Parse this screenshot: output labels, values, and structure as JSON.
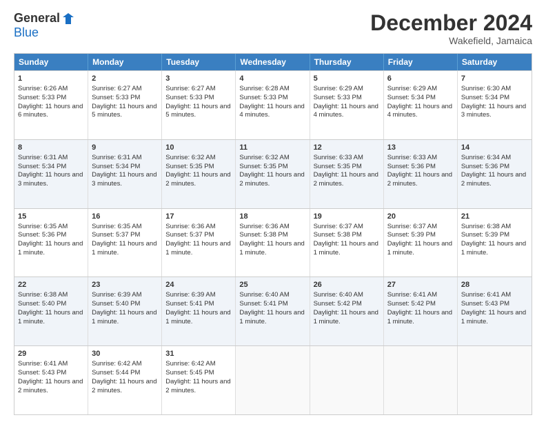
{
  "header": {
    "logo_general": "General",
    "logo_blue": "Blue",
    "month_title": "December 2024",
    "location": "Wakefield, Jamaica"
  },
  "days_of_week": [
    "Sunday",
    "Monday",
    "Tuesday",
    "Wednesday",
    "Thursday",
    "Friday",
    "Saturday"
  ],
  "weeks": [
    [
      {
        "day": 1,
        "sunrise": "6:26 AM",
        "sunset": "5:33 PM",
        "daylight": "11 hours and 6 minutes."
      },
      {
        "day": 2,
        "sunrise": "6:27 AM",
        "sunset": "5:33 PM",
        "daylight": "11 hours and 5 minutes."
      },
      {
        "day": 3,
        "sunrise": "6:27 AM",
        "sunset": "5:33 PM",
        "daylight": "11 hours and 5 minutes."
      },
      {
        "day": 4,
        "sunrise": "6:28 AM",
        "sunset": "5:33 PM",
        "daylight": "11 hours and 4 minutes."
      },
      {
        "day": 5,
        "sunrise": "6:29 AM",
        "sunset": "5:33 PM",
        "daylight": "11 hours and 4 minutes."
      },
      {
        "day": 6,
        "sunrise": "6:29 AM",
        "sunset": "5:34 PM",
        "daylight": "11 hours and 4 minutes."
      },
      {
        "day": 7,
        "sunrise": "6:30 AM",
        "sunset": "5:34 PM",
        "daylight": "11 hours and 3 minutes."
      }
    ],
    [
      {
        "day": 8,
        "sunrise": "6:31 AM",
        "sunset": "5:34 PM",
        "daylight": "11 hours and 3 minutes."
      },
      {
        "day": 9,
        "sunrise": "6:31 AM",
        "sunset": "5:34 PM",
        "daylight": "11 hours and 3 minutes."
      },
      {
        "day": 10,
        "sunrise": "6:32 AM",
        "sunset": "5:35 PM",
        "daylight": "11 hours and 2 minutes."
      },
      {
        "day": 11,
        "sunrise": "6:32 AM",
        "sunset": "5:35 PM",
        "daylight": "11 hours and 2 minutes."
      },
      {
        "day": 12,
        "sunrise": "6:33 AM",
        "sunset": "5:35 PM",
        "daylight": "11 hours and 2 minutes."
      },
      {
        "day": 13,
        "sunrise": "6:33 AM",
        "sunset": "5:36 PM",
        "daylight": "11 hours and 2 minutes."
      },
      {
        "day": 14,
        "sunrise": "6:34 AM",
        "sunset": "5:36 PM",
        "daylight": "11 hours and 2 minutes."
      }
    ],
    [
      {
        "day": 15,
        "sunrise": "6:35 AM",
        "sunset": "5:36 PM",
        "daylight": "11 hours and 1 minute."
      },
      {
        "day": 16,
        "sunrise": "6:35 AM",
        "sunset": "5:37 PM",
        "daylight": "11 hours and 1 minute."
      },
      {
        "day": 17,
        "sunrise": "6:36 AM",
        "sunset": "5:37 PM",
        "daylight": "11 hours and 1 minute."
      },
      {
        "day": 18,
        "sunrise": "6:36 AM",
        "sunset": "5:38 PM",
        "daylight": "11 hours and 1 minute."
      },
      {
        "day": 19,
        "sunrise": "6:37 AM",
        "sunset": "5:38 PM",
        "daylight": "11 hours and 1 minute."
      },
      {
        "day": 20,
        "sunrise": "6:37 AM",
        "sunset": "5:39 PM",
        "daylight": "11 hours and 1 minute."
      },
      {
        "day": 21,
        "sunrise": "6:38 AM",
        "sunset": "5:39 PM",
        "daylight": "11 hours and 1 minute."
      }
    ],
    [
      {
        "day": 22,
        "sunrise": "6:38 AM",
        "sunset": "5:40 PM",
        "daylight": "11 hours and 1 minute."
      },
      {
        "day": 23,
        "sunrise": "6:39 AM",
        "sunset": "5:40 PM",
        "daylight": "11 hours and 1 minute."
      },
      {
        "day": 24,
        "sunrise": "6:39 AM",
        "sunset": "5:41 PM",
        "daylight": "11 hours and 1 minute."
      },
      {
        "day": 25,
        "sunrise": "6:40 AM",
        "sunset": "5:41 PM",
        "daylight": "11 hours and 1 minute."
      },
      {
        "day": 26,
        "sunrise": "6:40 AM",
        "sunset": "5:42 PM",
        "daylight": "11 hours and 1 minute."
      },
      {
        "day": 27,
        "sunrise": "6:41 AM",
        "sunset": "5:42 PM",
        "daylight": "11 hours and 1 minute."
      },
      {
        "day": 28,
        "sunrise": "6:41 AM",
        "sunset": "5:43 PM",
        "daylight": "11 hours and 1 minute."
      }
    ],
    [
      {
        "day": 29,
        "sunrise": "6:41 AM",
        "sunset": "5:43 PM",
        "daylight": "11 hours and 2 minutes."
      },
      {
        "day": 30,
        "sunrise": "6:42 AM",
        "sunset": "5:44 PM",
        "daylight": "11 hours and 2 minutes."
      },
      {
        "day": 31,
        "sunrise": "6:42 AM",
        "sunset": "5:45 PM",
        "daylight": "11 hours and 2 minutes."
      },
      null,
      null,
      null,
      null
    ]
  ]
}
